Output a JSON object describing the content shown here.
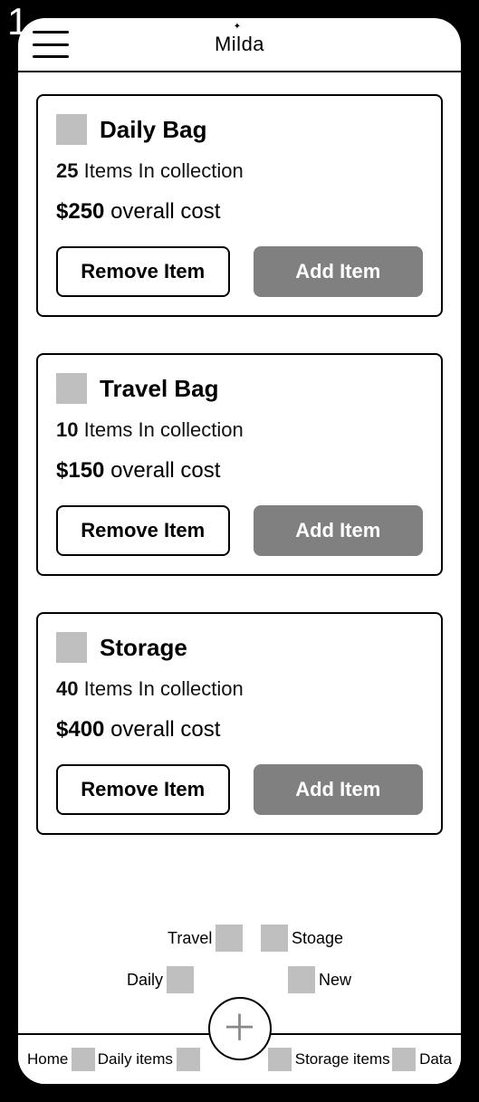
{
  "corner_number": "1",
  "header": {
    "logo": "Milda"
  },
  "cards": [
    {
      "title": "Daily Bag",
      "item_count": "25",
      "item_text": "Items In collection",
      "cost": "$250",
      "cost_text": "overall cost",
      "remove_label": "Remove Item",
      "add_label": "Add Item"
    },
    {
      "title": "Travel Bag",
      "item_count": "10",
      "item_text": "Items In collection",
      "cost": "$150",
      "cost_text": "overall cost",
      "remove_label": "Remove Item",
      "add_label": "Add Item"
    },
    {
      "title": "Storage",
      "item_count": "40",
      "item_text": "Items In collection",
      "cost": "$400",
      "cost_text": "overall cost",
      "remove_label": "Remove Item",
      "add_label": "Add Item"
    }
  ],
  "radial": {
    "travel": "Travel",
    "storage": "Stoage",
    "daily": "Daily",
    "new": "New"
  },
  "nav": {
    "home": "Home",
    "daily_items": "Daily items",
    "storage_items": "Storage items",
    "data": "Data"
  }
}
